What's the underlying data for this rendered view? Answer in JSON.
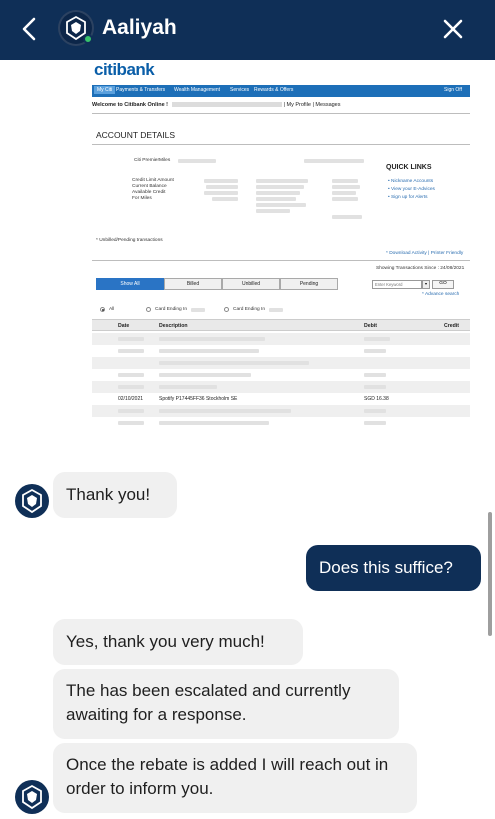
{
  "header": {
    "contact_name": "Aaliyah"
  },
  "statement": {
    "brand": "citibank",
    "nav": [
      "My Citi",
      "Payments & Transfers",
      "Wealth Management",
      "Services",
      "Rewards & Offers",
      "Sign Off"
    ],
    "welcome": "Welcome to Citibank Online !",
    "profile_links": "| My Profile | Messages",
    "title": "ACCOUNT DETAILS",
    "card_name": "Citi PremierMiles",
    "summary_labels": [
      "Credit Limit Amount",
      "Current Balance",
      "Available Credit",
      "For Miles"
    ],
    "quick_links_title": "QUICK LINKS",
    "quick_links": [
      "Nickname Accounts",
      "View your E-Advices",
      "Sign up for Alerts"
    ],
    "note": "* Unbilled/Pending transactions",
    "download_links": "Download Activity | Printer Friendly",
    "showing_since": "Showing Transactions Since : 24/08/2021",
    "tabs": [
      "Show All",
      "Billed",
      "Unbilled",
      "Pending"
    ],
    "keyword_placeholder": "Enter Keyword",
    "go_label": "GO",
    "advance_search": "Advance search",
    "filter_all": "All",
    "filter_card1": "Card Ending In",
    "filter_card2": "Card Ending In",
    "columns": [
      "Date",
      "Description",
      "Debit",
      "Credit"
    ],
    "visible_row": {
      "date": "02/10/2021",
      "description": "Spotify P17445FF36 Stockholm SE",
      "debit": "SGD 16.38"
    }
  },
  "messages": [
    {
      "from": "agent",
      "text": "Thank you!"
    },
    {
      "from": "user",
      "text": "Does this suffice?"
    },
    {
      "from": "agent",
      "text": "Yes, thank you very much!"
    },
    {
      "from": "agent",
      "text": "The has been escalated and currently awaiting for a response."
    },
    {
      "from": "agent",
      "text": "Once the rebate is added I will reach out in order to inform you."
    }
  ],
  "colors": {
    "header": "#0f2f57",
    "user_bubble": "#0f2f57",
    "agent_bubble": "#f0f0f0",
    "online": "#37c36a"
  }
}
